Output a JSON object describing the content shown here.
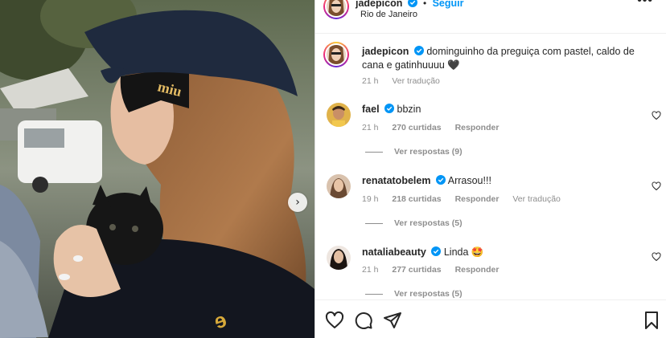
{
  "post": {
    "location": "Rio de Janeiro",
    "follow_label": "Seguir",
    "author": "jadepicon",
    "dot": "•",
    "more_label": "•••",
    "carousel_next": "›"
  },
  "caption": {
    "username": "jadepicon",
    "text": "dominguinho da preguiça com pastel, caldo de cana e gatinhuuuu 🖤",
    "time": "21 h",
    "translate": "Ver tradução"
  },
  "comments": [
    {
      "username": "fael",
      "text": "bbzin",
      "time": "21 h",
      "likes": "270 curtidas",
      "reply": "Responder",
      "replies_label": "Ver respostas (9)",
      "translate": ""
    },
    {
      "username": "renatatobelem",
      "text": "Arrasou!!!",
      "time": "19 h",
      "likes": "218 curtidas",
      "reply": "Responder",
      "replies_label": "Ver respostas (5)",
      "translate": "Ver tradução"
    },
    {
      "username": "nataliabeauty",
      "text": "Linda 🤩",
      "time": "21 h",
      "likes": "277 curtidas",
      "reply": "Responder",
      "replies_label": "Ver respostas (5)",
      "translate": ""
    }
  ],
  "icons": {
    "like": "heart-icon",
    "comment": "comment-icon",
    "share": "share-icon",
    "save": "bookmark-icon",
    "verified": "verified-badge-icon"
  },
  "colors": {
    "link_blue": "#0095f6",
    "verified_blue": "#0095f6",
    "muted_text": "#8e8e8e"
  }
}
